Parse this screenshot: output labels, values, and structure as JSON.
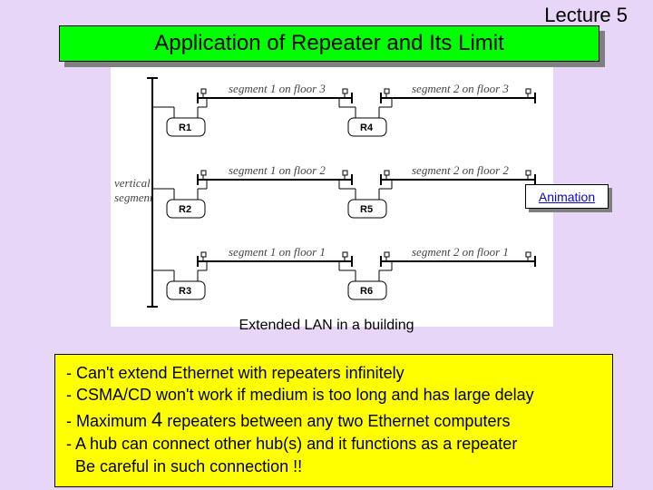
{
  "lecture_label": "Lecture 5",
  "title": "Application of Repeater and Its Limit",
  "animation_link": "Animation",
  "diagram": {
    "vertical_label_line1": "vertical",
    "vertical_label_line2": "segment",
    "rows": [
      {
        "left_label": "segment 1 on floor 3",
        "right_label": "segment 2 on floor 3",
        "r_left": "R1",
        "r_right": "R4"
      },
      {
        "left_label": "segment 1 on floor 2",
        "right_label": "segment 2 on floor 2",
        "r_left": "R2",
        "r_right": "R5"
      },
      {
        "left_label": "segment 1 on floor 1",
        "right_label": "segment 2 on floor 1",
        "r_left": "R3",
        "r_right": "R6"
      }
    ],
    "caption": "Extended LAN in a building"
  },
  "bullets": {
    "b1": "- Can't extend Ethernet with repeaters infinitely",
    "b2": "- CSMA/CD won't work if medium is too long and has large delay",
    "b3_pre": "- Maximum ",
    "b3_num": "4",
    "b3_post": " repeaters between any two Ethernet computers",
    "b4": "- A hub can connect other hub(s) and it functions as a repeater",
    "b5": "  Be careful in such connection !!"
  }
}
